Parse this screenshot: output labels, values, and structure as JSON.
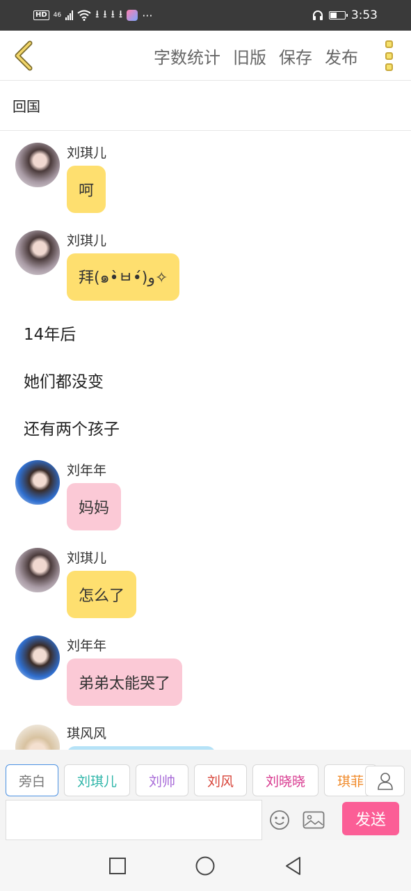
{
  "status_bar": {
    "hd": "HD",
    "network": "46",
    "time": "3:53",
    "more": "···",
    "battery_level": 0.4
  },
  "toolbar": {
    "word_count": "字数统计",
    "old_version": "旧版",
    "save": "保存",
    "publish": "发布"
  },
  "title": "回国",
  "messages": [
    {
      "type": "char",
      "sender": "刘琪儿",
      "text": "呵",
      "color": "#fedf6f"
    },
    {
      "type": "char",
      "sender": "刘琪儿",
      "text": "拜(๑•̀ㅂ•́)و✧",
      "color": "#fedf6f"
    },
    {
      "type": "narration",
      "text": "14年后"
    },
    {
      "type": "narration",
      "text": "她们都没变"
    },
    {
      "type": "narration",
      "text": "还有两个孩子"
    },
    {
      "type": "char",
      "sender": "刘年年",
      "text": "妈妈",
      "color": "#fbc9d6"
    },
    {
      "type": "char",
      "sender": "刘琪儿",
      "text": "怎么了",
      "color": "#fedf6f"
    },
    {
      "type": "char",
      "sender": "刘年年",
      "text": "弟弟太能哭了",
      "color": "#fbc9d6"
    },
    {
      "type": "char",
      "sender": "琪风风",
      "text": "",
      "color": "#b5e2f7"
    }
  ],
  "characters": [
    {
      "name": "旁白",
      "color": "#777777",
      "active": true
    },
    {
      "name": "刘琪儿",
      "color": "#2db5a8"
    },
    {
      "name": "刘帅",
      "color": "#a86bd8"
    },
    {
      "name": "刘风",
      "color": "#d8453a"
    },
    {
      "name": "刘晓晓",
      "color": "#d8398f"
    },
    {
      "name": "琪菲",
      "color": "#f08a2a"
    }
  ],
  "input": {
    "value": "",
    "placeholder": ""
  },
  "send_label": "发送",
  "icons": {
    "back": "chevron-left-icon",
    "more": "more-vertical-icon",
    "user": "user-icon",
    "emoji": "emoji-icon",
    "image": "image-icon",
    "nav_recent": "square-icon",
    "nav_home": "circle-icon",
    "nav_back": "triangle-back-icon"
  },
  "colors": {
    "accent_yellow": "#fedf6f",
    "accent_pink": "#fbc9d6",
    "send_button": "#fb5e96"
  }
}
